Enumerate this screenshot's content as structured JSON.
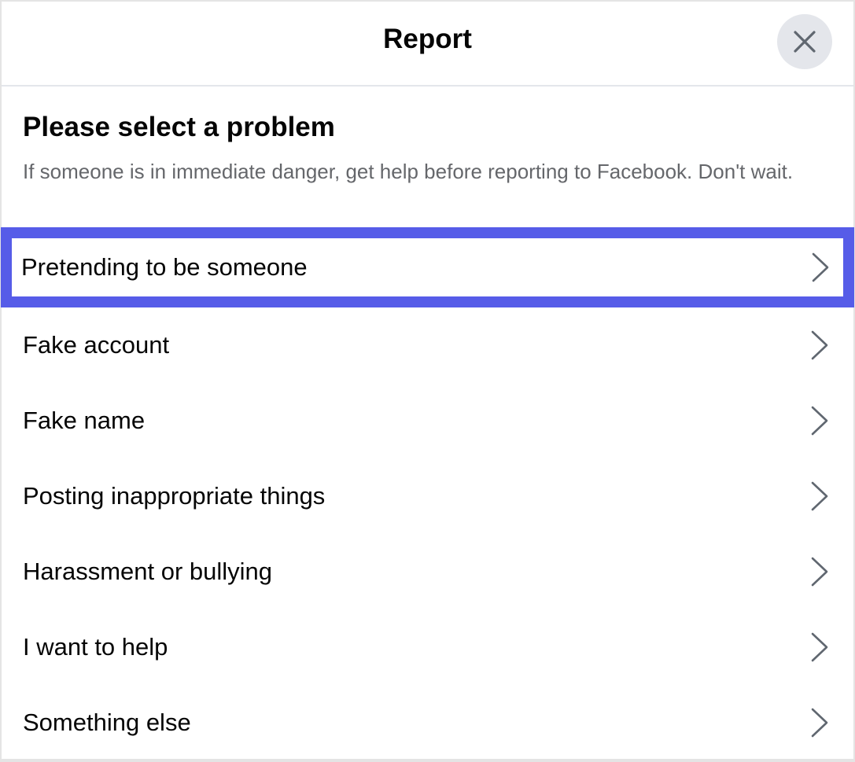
{
  "dialog": {
    "title": "Report",
    "close_icon": "close-icon"
  },
  "intro": {
    "heading": "Please select a problem",
    "subtext": "If someone is in immediate danger, get help before reporting to Facebook. Don't wait."
  },
  "options": [
    {
      "label": "Pretending to be someone",
      "selected": true,
      "icon": "chevron-right-icon"
    },
    {
      "label": "Fake account",
      "selected": false,
      "icon": "chevron-right-icon"
    },
    {
      "label": "Fake name",
      "selected": false,
      "icon": "chevron-right-icon"
    },
    {
      "label": "Posting inappropriate things",
      "selected": false,
      "icon": "chevron-right-icon"
    },
    {
      "label": "Harassment or bullying",
      "selected": false,
      "icon": "chevron-right-icon"
    },
    {
      "label": "I want to help",
      "selected": false,
      "icon": "chevron-right-icon"
    },
    {
      "label": "Something else",
      "selected": false,
      "icon": "chevron-right-icon"
    }
  ],
  "colors": {
    "highlight": "#565ce8",
    "close_bg": "#e4e6eb",
    "subtext": "#65676b"
  }
}
